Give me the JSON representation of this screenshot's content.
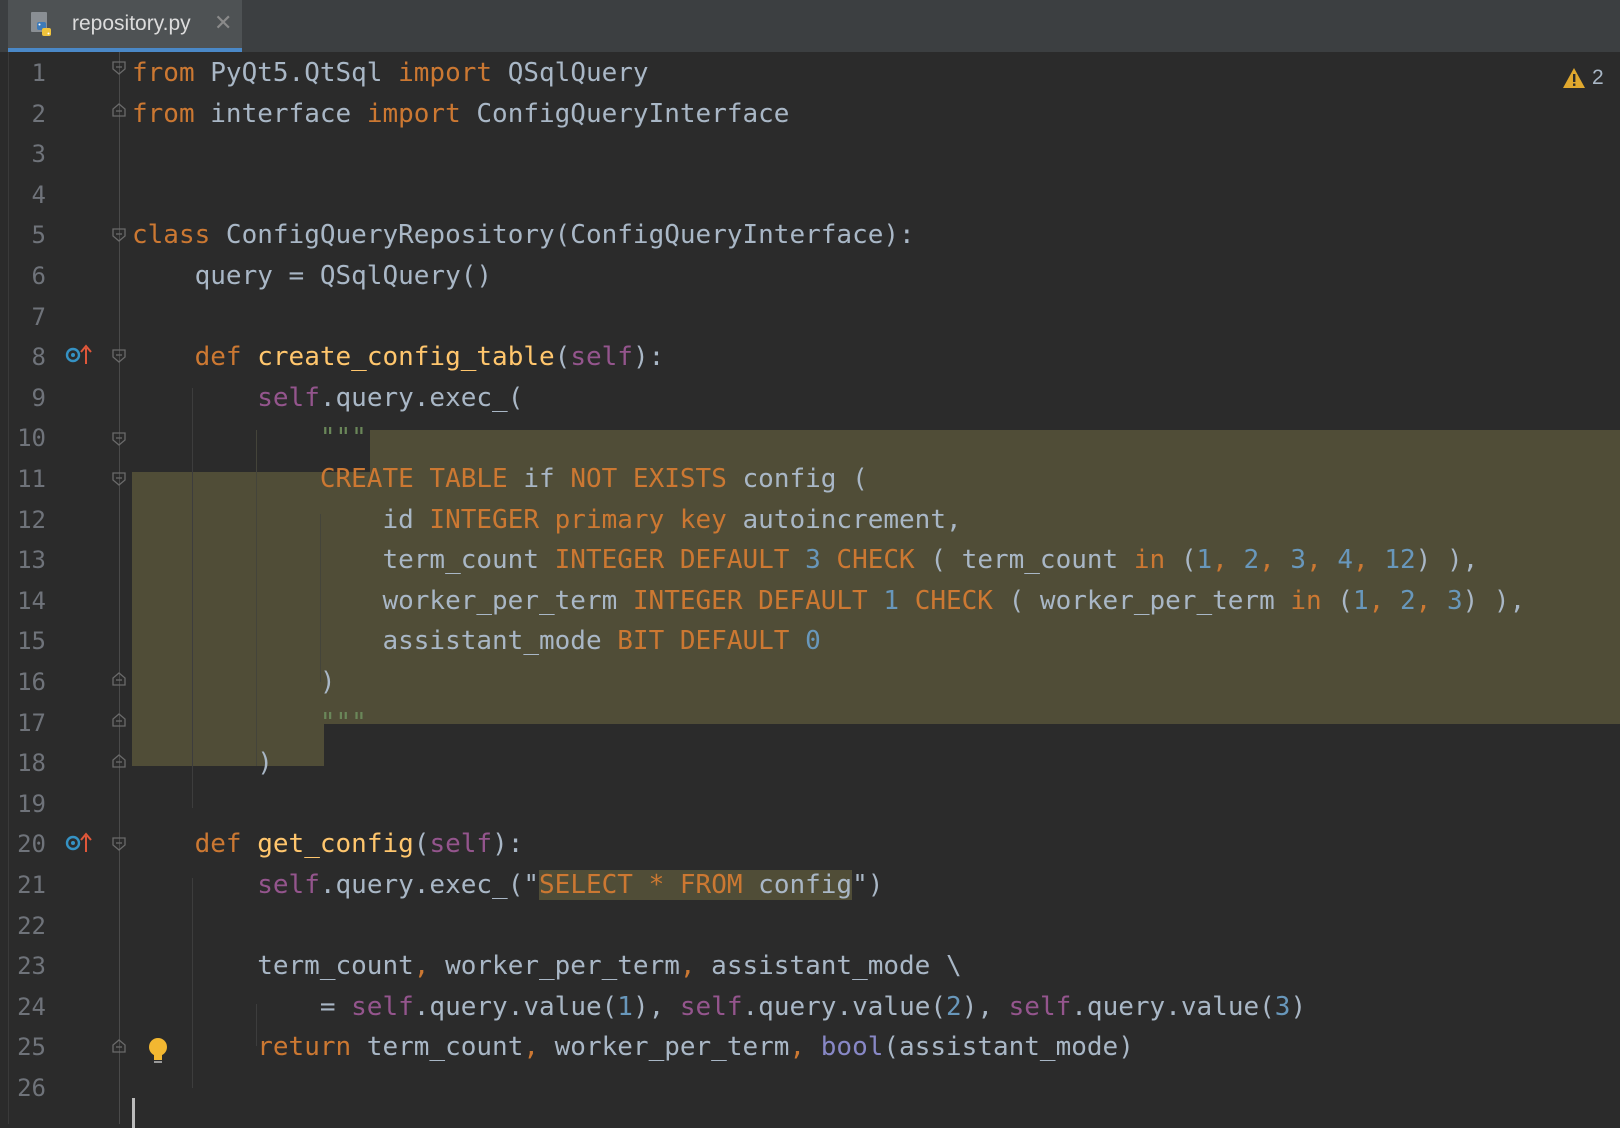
{
  "tab": {
    "filename": "repository.py",
    "icon": "python-file-icon",
    "close_icon": "close-icon",
    "close_glyph": "✕"
  },
  "inspection": {
    "icon": "warning-icon",
    "count": "2"
  },
  "colors": {
    "background": "#2b2b2b",
    "keyword": "#cc7832",
    "function": "#ffc66d",
    "self": "#94558d",
    "number": "#6897bb",
    "string": "#6a8759",
    "default": "#a9b7c6",
    "injection_highlight": "#504d37"
  },
  "lines": [
    {
      "n": "1"
    },
    {
      "n": "2"
    },
    {
      "n": "3"
    },
    {
      "n": "4"
    },
    {
      "n": "5"
    },
    {
      "n": "6"
    },
    {
      "n": "7"
    },
    {
      "n": "8"
    },
    {
      "n": "9"
    },
    {
      "n": "10"
    },
    {
      "n": "11"
    },
    {
      "n": "12"
    },
    {
      "n": "13"
    },
    {
      "n": "14"
    },
    {
      "n": "15"
    },
    {
      "n": "16"
    },
    {
      "n": "17"
    },
    {
      "n": "18"
    },
    {
      "n": "19"
    },
    {
      "n": "20"
    },
    {
      "n": "21"
    },
    {
      "n": "22"
    },
    {
      "n": "23"
    },
    {
      "n": "24"
    },
    {
      "n": "25"
    },
    {
      "n": "26"
    }
  ],
  "code": [
    [
      [
        "k",
        "from"
      ],
      [
        "",
        " PyQt5.QtSql "
      ],
      [
        "k",
        "import"
      ],
      [
        "",
        " QSqlQuery"
      ]
    ],
    [
      [
        "k",
        "from"
      ],
      [
        "",
        " interface "
      ],
      [
        "k",
        "import"
      ],
      [
        "",
        " ConfigQueryInterface"
      ]
    ],
    [],
    [],
    [
      [
        "k",
        "class"
      ],
      [
        "",
        " ConfigQueryRepository(ConfigQueryInterface):"
      ]
    ],
    [
      [
        "",
        "    query = QSqlQuery()"
      ]
    ],
    [],
    [
      [
        "",
        "    "
      ],
      [
        "k",
        "def"
      ],
      [
        "",
        " "
      ],
      [
        "fn",
        "create_config_table"
      ],
      [
        "",
        "("
      ],
      [
        "sf",
        "self"
      ],
      [
        "",
        "):"
      ]
    ],
    [
      [
        "",
        "        "
      ],
      [
        "sf",
        "self"
      ],
      [
        "",
        ".query.exec_("
      ]
    ],
    [
      [
        "",
        "            "
      ],
      [
        "st",
        "\"\"\""
      ]
    ],
    [
      [
        "",
        "            "
      ],
      [
        "sqk",
        "CREATE TABLE"
      ],
      [
        "",
        " if "
      ],
      [
        "sqk",
        "NOT EXISTS"
      ],
      [
        "",
        " config ("
      ]
    ],
    [
      [
        "",
        "                id "
      ],
      [
        "sqk",
        "INTEGER primary key"
      ],
      [
        "",
        " autoincrement,"
      ]
    ],
    [
      [
        "",
        "                term_count "
      ],
      [
        "sqk",
        "INTEGER DEFAULT"
      ],
      [
        "",
        " "
      ],
      [
        "nm",
        "3"
      ],
      [
        "",
        " "
      ],
      [
        "sqk",
        "CHECK"
      ],
      [
        "",
        " ( term_count "
      ],
      [
        "sqk",
        "in"
      ],
      [
        "",
        " ("
      ],
      [
        "nm",
        "1"
      ],
      [
        "k",
        ", "
      ],
      [
        "nm",
        "2"
      ],
      [
        "k",
        ", "
      ],
      [
        "nm",
        "3"
      ],
      [
        "k",
        ", "
      ],
      [
        "nm",
        "4"
      ],
      [
        "k",
        ", "
      ],
      [
        "nm",
        "12"
      ],
      [
        "",
        ") ),"
      ]
    ],
    [
      [
        "",
        "                worker_per_term "
      ],
      [
        "sqk",
        "INTEGER DEFAULT"
      ],
      [
        "",
        " "
      ],
      [
        "nm",
        "1"
      ],
      [
        "",
        " "
      ],
      [
        "sqk",
        "CHECK"
      ],
      [
        "",
        " ( worker_per_term "
      ],
      [
        "sqk",
        "in"
      ],
      [
        "",
        " ("
      ],
      [
        "nm",
        "1"
      ],
      [
        "k",
        ", "
      ],
      [
        "nm",
        "2"
      ],
      [
        "k",
        ", "
      ],
      [
        "nm",
        "3"
      ],
      [
        "",
        ") ),"
      ]
    ],
    [
      [
        "",
        "                assistant_mode "
      ],
      [
        "sqk",
        "BIT DEFAULT"
      ],
      [
        "",
        " "
      ],
      [
        "nm",
        "0"
      ]
    ],
    [
      [
        "",
        "            )"
      ]
    ],
    [
      [
        "",
        "            "
      ],
      [
        "st",
        "\"\"\""
      ]
    ],
    [
      [
        "",
        "        )"
      ]
    ],
    [],
    [
      [
        "",
        "    "
      ],
      [
        "k",
        "def"
      ],
      [
        "",
        " "
      ],
      [
        "fn",
        "get_config"
      ],
      [
        "",
        "("
      ],
      [
        "sf",
        "self"
      ],
      [
        "",
        "):"
      ]
    ],
    [
      [
        "",
        "        "
      ],
      [
        "sf",
        "self"
      ],
      [
        "",
        ".query.exec_(\""
      ],
      [
        "sqkh",
        "SELECT * FROM"
      ],
      [
        "strhl",
        " config"
      ],
      [
        "",
        "\")"
      ]
    ],
    [],
    [
      [
        "",
        "        term_count"
      ],
      [
        "k",
        ","
      ],
      [
        "",
        " worker_per_term"
      ],
      [
        "k",
        ","
      ],
      [
        "",
        " assistant_mode \\"
      ]
    ],
    [
      [
        "",
        "            = "
      ],
      [
        "sf",
        "self"
      ],
      [
        "",
        ".query.value("
      ],
      [
        "nm",
        "1"
      ],
      [
        "",
        "),"
      ],
      [
        "",
        " "
      ],
      [
        "sf",
        "self"
      ],
      [
        "",
        ".query.value("
      ],
      [
        "nm",
        "2"
      ],
      [
        "",
        "), "
      ],
      [
        "sf",
        "self"
      ],
      [
        "",
        ".query.value("
      ],
      [
        "nm",
        "3"
      ],
      [
        "",
        ")"
      ]
    ],
    [
      [
        "",
        "        "
      ],
      [
        "k",
        "return"
      ],
      [
        "",
        " term_count"
      ],
      [
        "k",
        ","
      ],
      [
        "",
        " worker_per_term"
      ],
      [
        "k",
        ","
      ],
      [
        "",
        " "
      ],
      [
        "bi",
        "bool"
      ],
      [
        "",
        "(assistant_mode)"
      ]
    ],
    []
  ]
}
